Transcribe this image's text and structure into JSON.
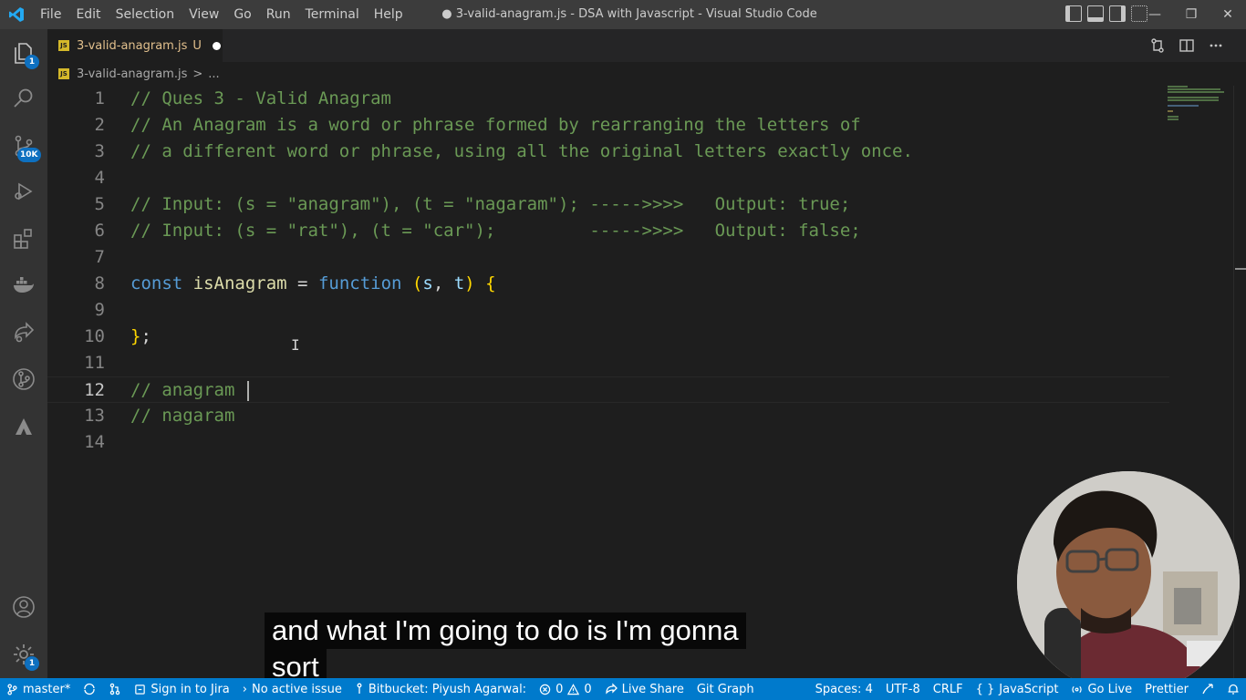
{
  "titlebar": {
    "menu": [
      "File",
      "Edit",
      "Selection",
      "View",
      "Go",
      "Run",
      "Terminal",
      "Help"
    ],
    "title": "● 3-valid-anagram.js - DSA with Javascript - Visual Studio Code",
    "controls": {
      "minimize": "—",
      "restore": "❐",
      "close": "✕"
    }
  },
  "activity": {
    "explorer_badge": "1",
    "source_control_badge": "10K",
    "settings_badge": "1"
  },
  "tab": {
    "icon_text": "JS",
    "filename": "3-valid-anagram.js",
    "status": "U"
  },
  "breadcrumbs": {
    "icon_text": "JS",
    "file": "3-valid-anagram.js",
    "separator": ">",
    "tail": "..."
  },
  "editor": {
    "current_line": 12,
    "line_numbers": [
      "1",
      "2",
      "3",
      "4",
      "5",
      "6",
      "7",
      "8",
      "9",
      "10",
      "11",
      "12",
      "13",
      "14"
    ],
    "lines": {
      "l1": "// Ques 3 - Valid Anagram",
      "l2": "// An Anagram is a word or phrase formed by rearranging the letters of",
      "l3": "// a different word or phrase, using all the original letters exactly once.",
      "l5": "// Input: (s = \"anagram\"), (t = \"nagaram\"); ----->>>>   Output: true;",
      "l6": "// Input: (s = \"rat\"), (t = \"car\");         ----->>>>   Output: false;",
      "l8": {
        "kw_const": "const",
        "name": "isAnagram",
        "eq": " = ",
        "kw_function": "function",
        "paren_open": "(",
        "param_s": "s",
        "comma": ", ",
        "param_t": "t",
        "paren_close": ")",
        "brace": "{"
      },
      "l10": {
        "brace": "}",
        "semi": ";"
      },
      "l12": "// anagram ",
      "l13": "// nagaram"
    }
  },
  "subtitle": {
    "line1": "and what I'm going to do is I'm gonna",
    "line2": "sort"
  },
  "statusbar": {
    "branch": "master*",
    "jira": "Sign in to Jira",
    "issue": "No active issue",
    "bitbucket": "Bitbucket: Piyush Agarwal:",
    "errors": "0",
    "warnings": "0",
    "live_share": "Live Share",
    "git_graph": "Git Graph",
    "spaces": "Spaces: 4",
    "encoding": "UTF-8",
    "eol": "CRLF",
    "language_braces": "{ }",
    "language": "JavaScript",
    "go_live": "Go Live",
    "prettier": "Prettier"
  },
  "colors": {
    "statusbar": "#007acc",
    "comment": "#6a9955",
    "keyword": "#569cd6",
    "function": "#dcdcaa",
    "variable": "#9cdcfe",
    "bracket_gold": "#ffd700",
    "bracket_purple": "#da70d6"
  }
}
